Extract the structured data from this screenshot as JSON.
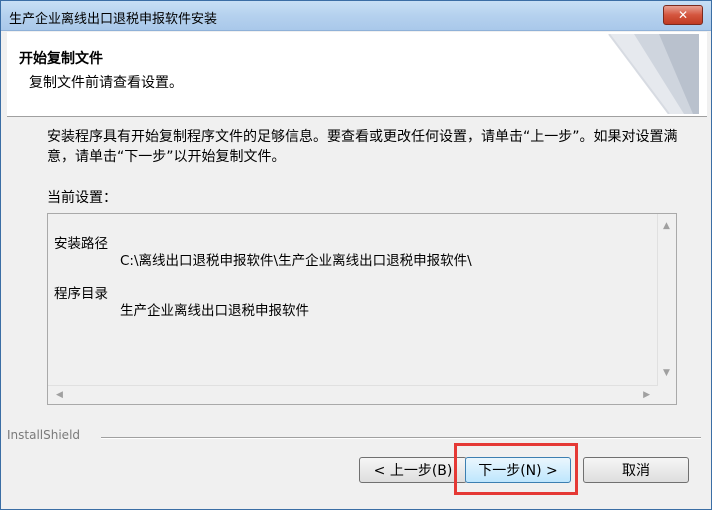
{
  "window": {
    "title": "生产企业离线出口退税申报软件安装",
    "close_glyph": "✕"
  },
  "header": {
    "title": "开始复制文件",
    "subtitle": "复制文件前请查看设置。"
  },
  "body": {
    "instructions": "安装程序具有开始复制程序文件的足够信息。要查看或更改任何设置，请单击“上一步”。如果对设置满意，请单击“下一步”以开始复制文件。",
    "current_settings_label": "当前设置：",
    "settings": [
      {
        "key": "安装路径",
        "value": "C:\\离线出口退税申报软件\\生产企业离线出口退税申报软件\\"
      },
      {
        "key": "程序目录",
        "value": "生产企业离线出口退税申报软件"
      }
    ],
    "scroll_up_glyph": "▲",
    "scroll_down_glyph": "▼",
    "scroll_left_glyph": "◀",
    "scroll_right_glyph": "▶"
  },
  "footer": {
    "brand": "InstallShield",
    "back_label": "< 上一步(B)",
    "next_label": "下一步(N) >",
    "cancel_label": "取消"
  },
  "colors": {
    "highlight": "#e53935",
    "close_button": "#d4553e"
  }
}
